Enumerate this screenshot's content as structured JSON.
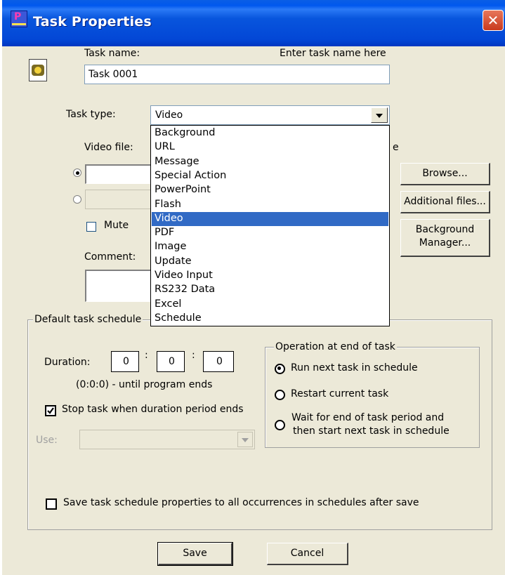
{
  "window": {
    "title": "Task Properties",
    "close_glyph": "✕"
  },
  "task_name": {
    "label": "Task name:",
    "hint": "Enter task name here",
    "value": "Task 0001"
  },
  "task_type": {
    "label": "Task type:",
    "selected": "Video",
    "options": [
      "Background",
      "URL",
      "Message",
      "Special Action",
      "PowerPoint",
      "Flash",
      "Video",
      "PDF",
      "Image",
      "Update",
      "Video Input",
      "RS232 Data",
      "Excel",
      "Schedule"
    ],
    "selected_index": 6
  },
  "video": {
    "label": "Video file:",
    "partial_label": "e",
    "mute_label": "Mute"
  },
  "buttons": {
    "browse": "Browse...",
    "additional_files": "Additional files...",
    "background_manager_line1": "Background",
    "background_manager_line2": "Manager...",
    "save": "Save",
    "cancel": "Cancel"
  },
  "comment": {
    "label": "Comment:"
  },
  "schedule": {
    "legend": "Default task schedule",
    "duration_label": "Duration:",
    "duration_hours": "0",
    "duration_minutes": "0",
    "duration_seconds": "0",
    "separator": ":",
    "duration_note": "(0:0:0) - until program ends",
    "stop_task_label": "Stop task when duration period ends",
    "stop_task_checked": true,
    "use_label": "Use:",
    "save_all_label": "Save task schedule properties to all occurrences in schedules after save",
    "save_all_checked": false
  },
  "end_operation": {
    "legend": "Operation at end of task",
    "options": [
      {
        "label": "Run next task in schedule",
        "selected": true
      },
      {
        "label": "Restart current task",
        "selected": false
      },
      {
        "label_line1": "Wait for end of task period and",
        "label_line2": "then start next task in schedule",
        "selected": false
      }
    ]
  },
  "colors": {
    "titlebar": "#0054e3",
    "selection": "#316ac5",
    "dialog_bg": "#ece9d8",
    "close_button": "#d44a2a"
  },
  "icons": [
    "task-icon",
    "app-icon",
    "close-icon",
    "dropdown-arrow-icon",
    "check-icon",
    "radio-dot-icon"
  ]
}
